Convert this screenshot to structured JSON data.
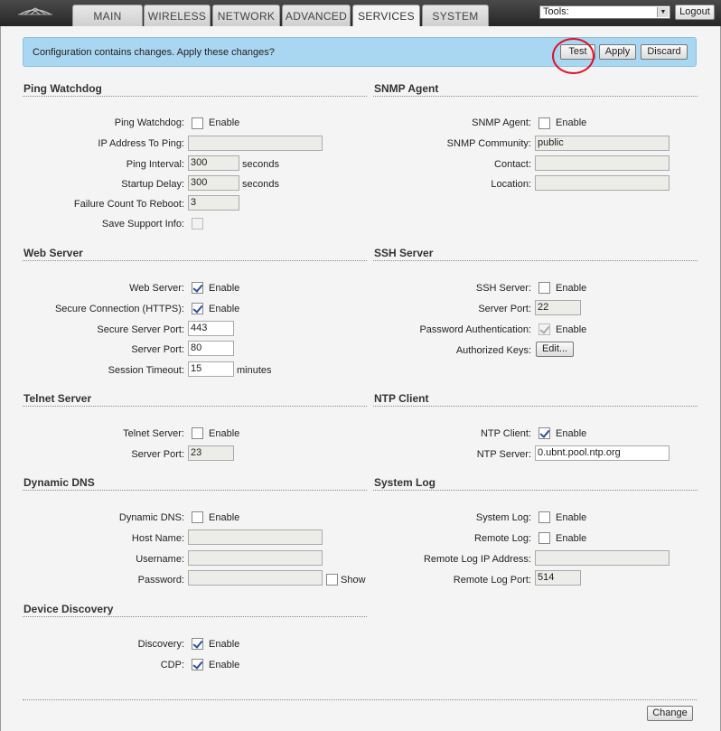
{
  "header": {
    "tabs": [
      {
        "label": "MAIN"
      },
      {
        "label": "WIRELESS"
      },
      {
        "label": "NETWORK"
      },
      {
        "label": "ADVANCED"
      },
      {
        "label": "SERVICES",
        "active": true
      },
      {
        "label": "SYSTEM"
      }
    ],
    "tools_label": "Tools:",
    "logout_label": "Logout",
    "logo_icon": "ubiquiti-logo-icon"
  },
  "banner": {
    "text": "Configuration contains changes. Apply these changes?",
    "test_label": "Test",
    "apply_label": "Apply",
    "discard_label": "Discard",
    "highlight_color": "#e0102a"
  },
  "ping_watchdog": {
    "title": "Ping Watchdog",
    "watchdog_label": "Ping Watchdog:",
    "watchdog_enable": "Enable",
    "ip_label": "IP Address To Ping:",
    "ip_value": "",
    "interval_label": "Ping Interval:",
    "interval_value": "300",
    "interval_unit": "seconds",
    "startup_label": "Startup Delay:",
    "startup_value": "300",
    "startup_unit": "seconds",
    "failure_label": "Failure Count To Reboot:",
    "failure_value": "3",
    "support_label": "Save Support Info:"
  },
  "snmp": {
    "title": "SNMP Agent",
    "agent_label": "SNMP Agent:",
    "agent_enable": "Enable",
    "community_label": "SNMP Community:",
    "community_value": "public",
    "contact_label": "Contact:",
    "contact_value": "",
    "location_label": "Location:",
    "location_value": ""
  },
  "web_server": {
    "title": "Web Server",
    "web_label": "Web Server:",
    "web_enable": "Enable",
    "secure_label": "Secure Connection (HTTPS):",
    "secure_enable": "Enable",
    "secure_port_label": "Secure Server Port:",
    "secure_port_value": "443",
    "port_label": "Server Port:",
    "port_value": "80",
    "timeout_label": "Session Timeout:",
    "timeout_value": "15",
    "timeout_unit": "minutes"
  },
  "ssh": {
    "title": "SSH Server",
    "ssh_label": "SSH Server:",
    "ssh_enable": "Enable",
    "port_label": "Server Port:",
    "port_value": "22",
    "pass_label": "Password Authentication:",
    "pass_enable": "Enable",
    "keys_label": "Authorized Keys:",
    "keys_button": "Edit..."
  },
  "telnet": {
    "title": "Telnet Server",
    "telnet_label": "Telnet Server:",
    "telnet_enable": "Enable",
    "port_label": "Server Port:",
    "port_value": "23"
  },
  "ntp": {
    "title": "NTP Client",
    "client_label": "NTP Client:",
    "client_enable": "Enable",
    "server_label": "NTP Server:",
    "server_value": "0.ubnt.pool.ntp.org"
  },
  "ddns": {
    "title": "Dynamic DNS",
    "ddns_label": "Dynamic DNS:",
    "ddns_enable": "Enable",
    "host_label": "Host Name:",
    "host_value": "",
    "user_label": "Username:",
    "user_value": "",
    "pass_label": "Password:",
    "pass_value": "",
    "show_label": "Show"
  },
  "syslog": {
    "title": "System Log",
    "syslog_label": "System Log:",
    "syslog_enable": "Enable",
    "remote_label": "Remote Log:",
    "remote_enable": "Enable",
    "remote_ip_label": "Remote Log IP Address:",
    "remote_ip_value": "",
    "remote_port_label": "Remote Log Port:",
    "remote_port_value": "514"
  },
  "discovery": {
    "title": "Device Discovery",
    "discovery_label": "Discovery:",
    "discovery_enable": "Enable",
    "cdp_label": "CDP:",
    "cdp_enable": "Enable"
  },
  "footer": {
    "change_label": "Change"
  }
}
